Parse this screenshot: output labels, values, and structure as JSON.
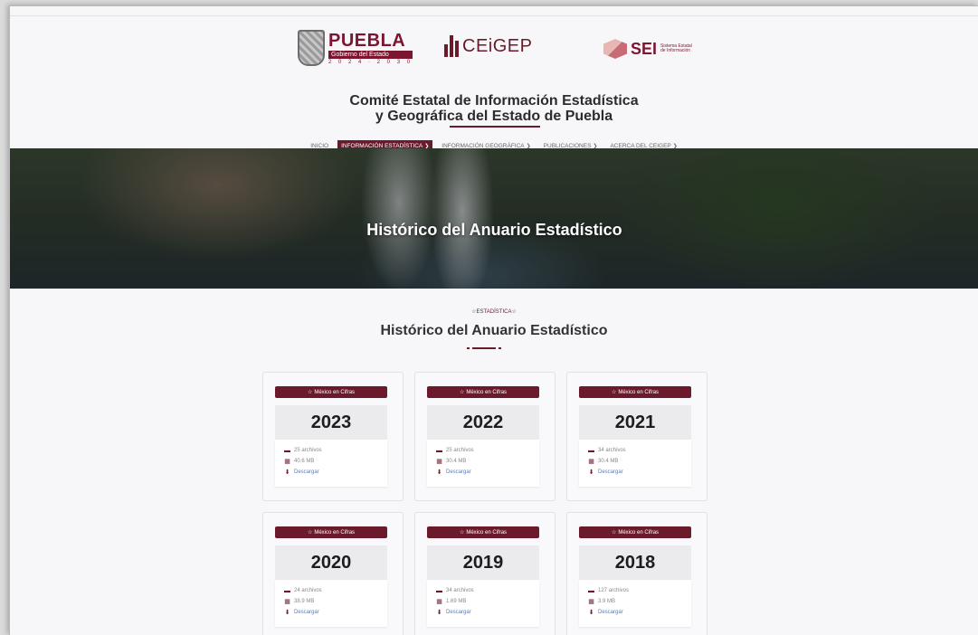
{
  "header": {
    "puebla": {
      "name": "PUEBLA",
      "subtitle": "Gobierno del Estado",
      "years": "2 0 2 4 · 2 0 3 0"
    },
    "ceigep": {
      "name": "CEiGEP"
    },
    "sei": {
      "name": "SEI",
      "subtitle": "Sistema Estatal de Información"
    },
    "title_line1": "Comité Estatal de Información Estadística",
    "title_line2": "y Geográfica del Estado de Puebla"
  },
  "nav": {
    "items": [
      {
        "label": "INICIO",
        "dropdown": false,
        "active": false
      },
      {
        "label": "INFORMACIÓN ESTADÍSTICA",
        "dropdown": true,
        "active": true
      },
      {
        "label": "INFORMACIÓN GEOGRÁFICA",
        "dropdown": true,
        "active": false
      },
      {
        "label": "PUBLICACIONES",
        "dropdown": true,
        "active": false
      },
      {
        "label": "ACERCA DEL CEIGEP",
        "dropdown": true,
        "active": false
      }
    ]
  },
  "hero": {
    "title": "Histórico del Anuario Estadístico"
  },
  "section": {
    "eyebrow": "ESTADÍSTICA",
    "title": "Histórico del Anuario Estadístico"
  },
  "cards": [
    {
      "badge": "México en Cifras",
      "year": "2023",
      "files": "25 archivos",
      "size": "40.6 MB",
      "download": "Descargar"
    },
    {
      "badge": "México en Cifras",
      "year": "2022",
      "files": "25 archivos",
      "size": "30.4 MB",
      "download": "Descargar"
    },
    {
      "badge": "México en Cifras",
      "year": "2021",
      "files": "34 archivos",
      "size": "30.4 MB",
      "download": "Descargar"
    },
    {
      "badge": "México en Cifras",
      "year": "2020",
      "files": "24 archivos",
      "size": "38.9 MB",
      "download": "Descargar"
    },
    {
      "badge": "México en Cifras",
      "year": "2019",
      "files": "34 archivos",
      "size": "1.69 MB",
      "download": "Descargar"
    },
    {
      "badge": "México en Cifras",
      "year": "2018",
      "files": "127 archivos",
      "size": "3.9 MB",
      "download": "Descargar"
    }
  ],
  "icons": {
    "star": "star-icon",
    "folder": "folder-icon",
    "file": "file-icon",
    "download": "download-icon",
    "chevron": "chevron-down-icon"
  },
  "colors": {
    "brand": "#6b1a2c",
    "link": "#5a7bb5"
  }
}
